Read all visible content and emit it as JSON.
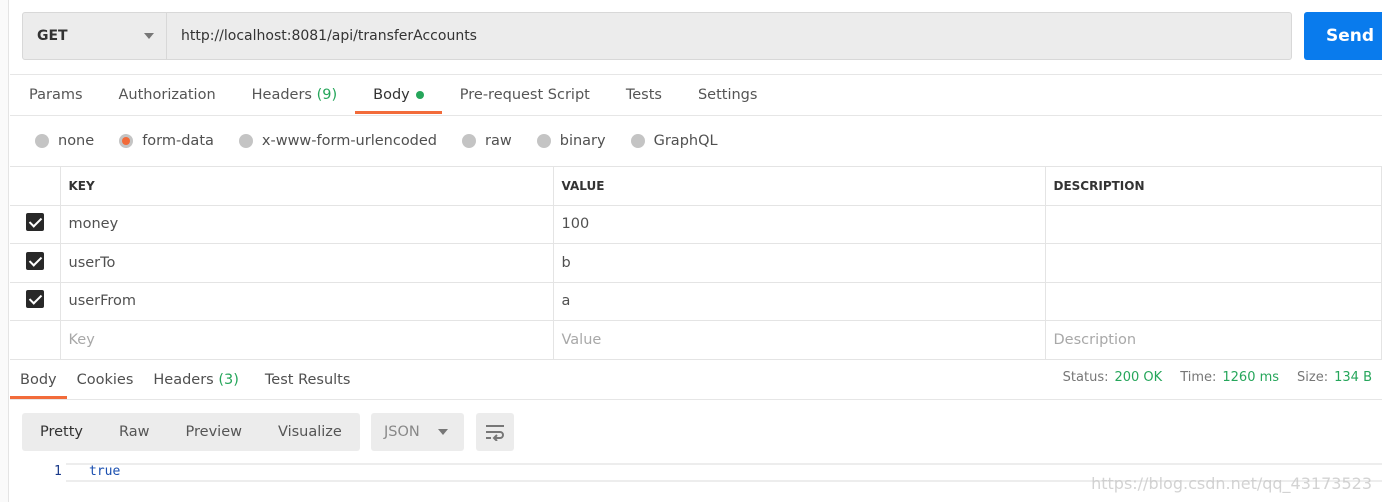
{
  "request": {
    "method": "GET",
    "url": "http://localhost:8081/api/transferAccounts",
    "send_label": "Send"
  },
  "request_tabs": [
    {
      "label": "Params"
    },
    {
      "label": "Authorization"
    },
    {
      "label": "Headers",
      "count": "(9)"
    },
    {
      "label": "Body",
      "active": true
    },
    {
      "label": "Pre-request Script"
    },
    {
      "label": "Tests"
    },
    {
      "label": "Settings"
    }
  ],
  "body_modes": [
    "none",
    "form-data",
    "x-www-form-urlencoded",
    "raw",
    "binary",
    "GraphQL"
  ],
  "body_mode_selected": "form-data",
  "table": {
    "headers": [
      "KEY",
      "VALUE",
      "DESCRIPTION"
    ],
    "rows": [
      {
        "checked": true,
        "key": "money",
        "value": "100",
        "description": ""
      },
      {
        "checked": true,
        "key": "userTo",
        "value": "b",
        "description": ""
      },
      {
        "checked": true,
        "key": "userFrom",
        "value": "a",
        "description": ""
      }
    ],
    "placeholders": {
      "key": "Key",
      "value": "Value",
      "description": "Description"
    }
  },
  "response_tabs": [
    {
      "label": "Body",
      "active": true
    },
    {
      "label": "Cookies"
    },
    {
      "label": "Headers",
      "count": "(3)"
    },
    {
      "label": "Test Results"
    }
  ],
  "response_meta": {
    "status_label": "Status:",
    "status": "200 OK",
    "time_label": "Time:",
    "time": "1260 ms",
    "size_label": "Size:",
    "size": "134 B"
  },
  "view_modes": [
    "Pretty",
    "Raw",
    "Preview",
    "Visualize"
  ],
  "format": "JSON",
  "response_body": {
    "line": "1",
    "text": "true"
  },
  "watermark": "https://blog.csdn.net/qq_43173523",
  "colors": {
    "accent": "#f26b3a",
    "send": "#097bed",
    "success": "#26a65b"
  }
}
